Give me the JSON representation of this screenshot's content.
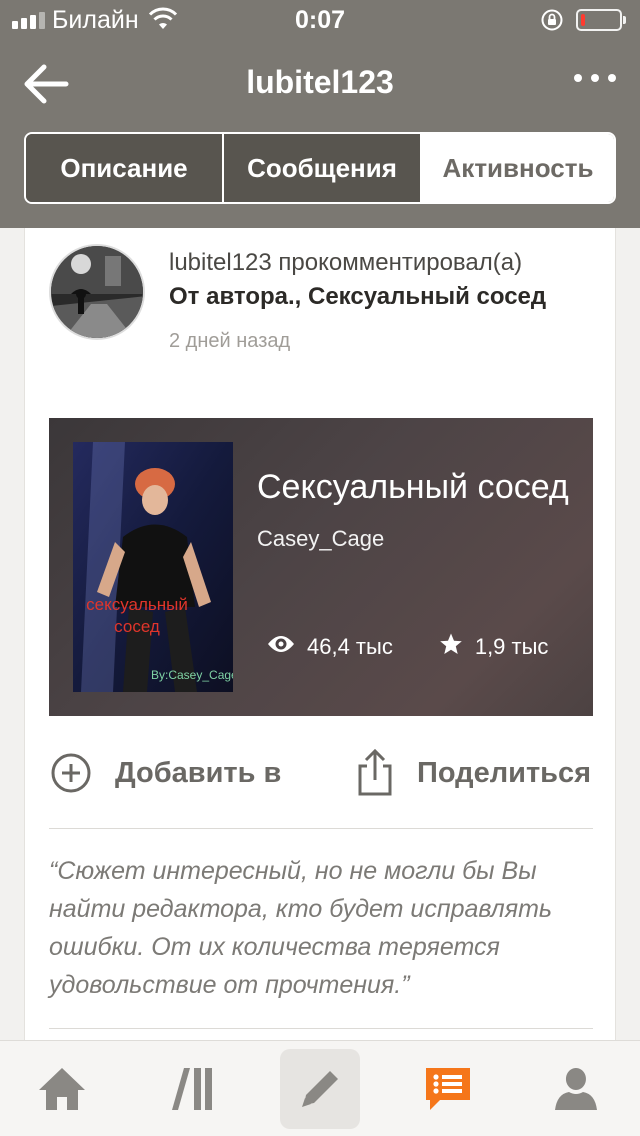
{
  "status_bar": {
    "carrier": "Билайн",
    "time": "0:07",
    "battery_level": 0.1,
    "colors": {
      "battery_low": "#ff3b30"
    }
  },
  "header": {
    "title": "lubitel123"
  },
  "tabs": [
    {
      "label": "Описание",
      "selected": false
    },
    {
      "label": "Сообщения",
      "selected": false
    },
    {
      "label": "Активность",
      "selected": true
    }
  ],
  "activity": {
    "user": "lubitel123",
    "action": "прокомментировал(а)",
    "story_ref": "От автора., Сексуальный сосед",
    "time_ago": "2 дней назад",
    "story": {
      "title": "Сексуальный сосед",
      "author": "Casey_Cage",
      "reads": "46,4 тыс",
      "votes": "1,9 тыс",
      "cover_text": "сексуальный сосед",
      "cover_byline": "By:Casey_Cage"
    },
    "add_label": "Добавить в",
    "share_label": "Поделиться",
    "comment": "“Сюжет интересный, но не могли бы Вы найти редактора, кто будет исправлять ошибки. От их количества теряется удовольствие от прочтения.”"
  },
  "bottom_nav": {
    "items": [
      "home-icon",
      "library-icon",
      "write-icon",
      "messages-icon",
      "profile-icon"
    ],
    "active": "messages-icon",
    "colors": {
      "active": "#f5761a",
      "inactive": "#8a8884"
    }
  }
}
